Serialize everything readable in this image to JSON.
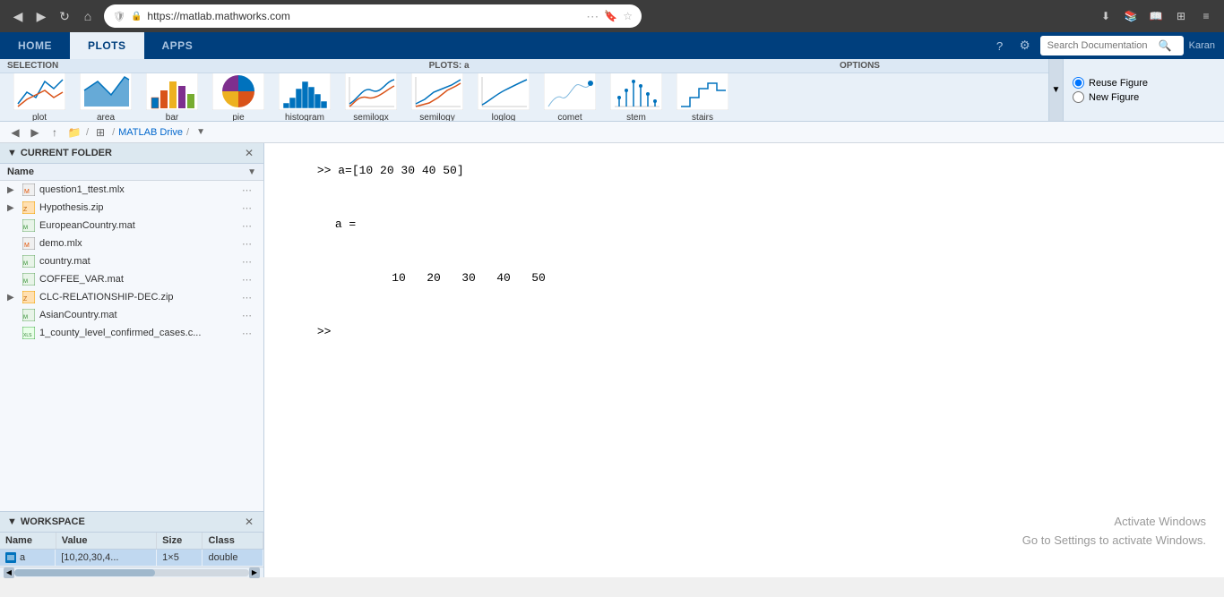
{
  "browser": {
    "url": "https://matlab.mathworks.com",
    "back_btn": "◀",
    "forward_btn": "▶",
    "refresh_btn": "↻",
    "home_btn": "⌂"
  },
  "nav": {
    "tabs": [
      "HOME",
      "PLOTS",
      "APPS"
    ],
    "active_tab": "PLOTS",
    "search_placeholder": "Search Documentation",
    "user_name": "Karan"
  },
  "toolbar": {
    "section_label": "SELECTION",
    "plots_label": "PLOTS: a",
    "options_label": "OPTIONS",
    "plots": [
      {
        "name": "plot",
        "label": "plot"
      },
      {
        "name": "area",
        "label": "area"
      },
      {
        "name": "bar",
        "label": "bar"
      },
      {
        "name": "pie",
        "label": "pie"
      },
      {
        "name": "histogram",
        "label": "histogram"
      },
      {
        "name": "semilogx",
        "label": "semilogx"
      },
      {
        "name": "semilogy",
        "label": "semilogy"
      },
      {
        "name": "loglog",
        "label": "loglog"
      },
      {
        "name": "comet",
        "label": "comet"
      },
      {
        "name": "stem",
        "label": "stem"
      },
      {
        "name": "stairs",
        "label": "stairs"
      }
    ],
    "reuse_figure_label": "Reuse Figure",
    "new_figure_label": "New Figure"
  },
  "path_bar": {
    "items": [
      "MATLAB Drive"
    ],
    "current_var": "a"
  },
  "current_folder": {
    "header": "CURRENT FOLDER",
    "col_name": "Name",
    "col_sort": "▼",
    "files": [
      {
        "name": "question1_ttest.mlx",
        "type": "mlx",
        "expandable": true,
        "indent": 1
      },
      {
        "name": "Hypothesis.zip",
        "type": "zip",
        "expandable": true,
        "indent": 0
      },
      {
        "name": "EuropeanCountry.mat",
        "type": "mat",
        "expandable": false,
        "indent": 0
      },
      {
        "name": "demo.mlx",
        "type": "mlx",
        "expandable": false,
        "indent": 0
      },
      {
        "name": "country.mat",
        "type": "mat",
        "expandable": false,
        "indent": 0
      },
      {
        "name": "COFFEE_VAR.mat",
        "type": "mat",
        "expandable": false,
        "indent": 0
      },
      {
        "name": "CLC-RELATIONSHIP-DEC.zip",
        "type": "zip",
        "expandable": true,
        "indent": 0
      },
      {
        "name": "AsianCountry.mat",
        "type": "mat",
        "expandable": false,
        "indent": 0
      },
      {
        "name": "1_county_level_confirmed_cases.c...",
        "type": "xlsx",
        "expandable": false,
        "indent": 0
      }
    ]
  },
  "workspace": {
    "header": "WORKSPACE",
    "columns": [
      "Name",
      "Value",
      "Size",
      "Class"
    ],
    "rows": [
      {
        "name": "a",
        "value": "[10,20,30,4...",
        "size": "1×5",
        "class": "double",
        "selected": true
      }
    ]
  },
  "command_window": {
    "lines": [
      {
        "type": "input",
        "text": ">> a=[10 20 30 40 50]"
      },
      {
        "type": "blank",
        "text": ""
      },
      {
        "type": "output",
        "text": "a ="
      },
      {
        "type": "blank",
        "text": ""
      },
      {
        "type": "values",
        "text": "   10   20   30   40   50"
      },
      {
        "type": "blank",
        "text": ""
      },
      {
        "type": "prompt",
        "text": ">>"
      }
    ]
  },
  "watermark": {
    "line1": "Activate Windows",
    "line2": "Go to Settings to activate Windows."
  }
}
